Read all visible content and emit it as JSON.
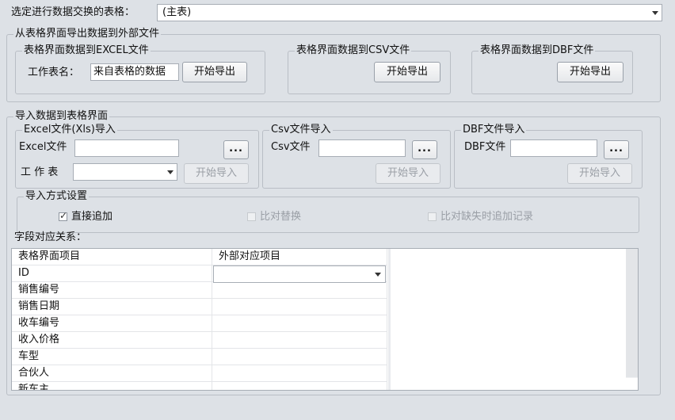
{
  "top": {
    "label": "选定进行数据交换的表格：",
    "selected": "(主表)"
  },
  "export_group": {
    "title": "从表格界面导出数据到外部文件",
    "excel": {
      "title": "表格界面数据到EXCEL文件",
      "sheet_label": "工作表名：",
      "sheet_value": "来自表格的数据",
      "button": "开始导出"
    },
    "csv": {
      "title": "表格界面数据到CSV文件",
      "button": "开始导出"
    },
    "dbf": {
      "title": "表格界面数据到DBF文件",
      "button": "开始导出"
    }
  },
  "import_group": {
    "title": "导入数据到表格界面",
    "excel": {
      "title": "Excel文件(Xls)导入",
      "file_label": "Excel文件",
      "browse": "...",
      "sheet_label": "工 作 表",
      "button": "开始导入"
    },
    "csv": {
      "title": "Csv文件导入",
      "file_label": "Csv文件",
      "browse": "...",
      "button": "开始导入"
    },
    "dbf": {
      "title": "DBF文件导入",
      "file_label": "DBF文件",
      "browse": "...",
      "button": "开始导入"
    },
    "mode": {
      "title": "导入方式设置",
      "options": [
        {
          "label": "直接追加",
          "checked": true,
          "enabled": true
        },
        {
          "label": "比对替换",
          "checked": false,
          "enabled": false
        },
        {
          "label": "比对缺失时追加记录",
          "checked": false,
          "enabled": false
        }
      ]
    }
  },
  "mapping": {
    "label": "字段对应关系：",
    "headers": [
      "表格界面项目",
      "外部对应项目"
    ],
    "rows": [
      "ID",
      "销售编号",
      "销售日期",
      "收车编号",
      "收入价格",
      "车型",
      "合伙人",
      "新车主"
    ]
  }
}
